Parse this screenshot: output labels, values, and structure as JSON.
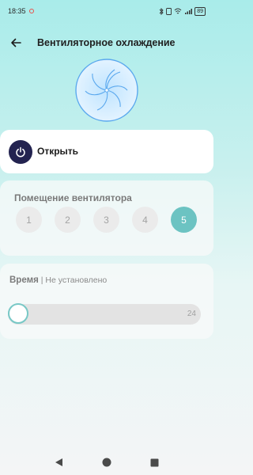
{
  "status_bar": {
    "time": "18:35",
    "battery": "89",
    "right_icons": [
      "bluetooth-icon",
      "sim-icon",
      "wifi-icon",
      "signal-icon",
      "battery-icon"
    ]
  },
  "header": {
    "title": "Вентиляторное охлаждение",
    "back_icon": "arrow-left-icon"
  },
  "fan": {
    "icon": "fan-icon",
    "color": "#5aa8ee"
  },
  "power_card": {
    "label": "Открыть",
    "icon": "power-icon"
  },
  "room_card": {
    "title": "Помещение вентилятора",
    "levels": [
      "1",
      "2",
      "3",
      "4",
      "5"
    ],
    "selected": "5"
  },
  "time_card": {
    "title": "Время",
    "separator": "|",
    "status": "Не установлено",
    "slider_max": "24",
    "slider_value_fraction": 0
  },
  "colors": {
    "accent": "#6cc3c2",
    "power_button": "#232350",
    "background_top": "#a9ecea"
  },
  "nav_bar": [
    "back-triangle-icon",
    "home-circle-icon",
    "recents-square-icon"
  ]
}
